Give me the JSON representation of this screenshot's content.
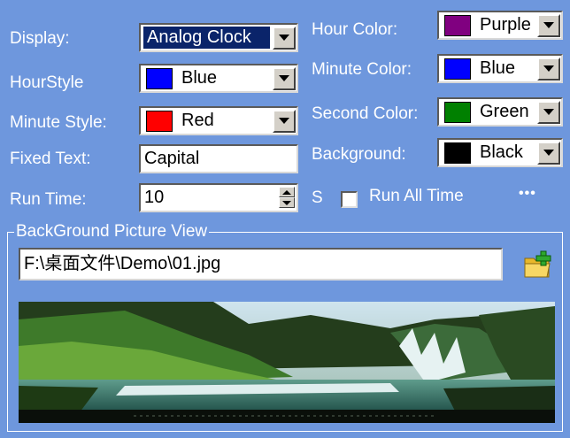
{
  "labels": {
    "display": "Display:",
    "hour_style": "HourStyle",
    "minute_style": "Minute Style:",
    "fixed_text": "Fixed Text:",
    "run_time": "Run Time:",
    "hour_color": "Hour Color:",
    "minute_color": "Minute Color:",
    "second_color": "Second Color:",
    "background": "Background:",
    "seconds_unit": "S",
    "run_all_time": "Run All Time",
    "more": "•••"
  },
  "fields": {
    "display": "Analog Clock",
    "hour_style": "Blue",
    "minute_style": "Red",
    "fixed_text": "Capital",
    "run_time": "10",
    "hour_color": "Purple",
    "minute_color": "Blue",
    "second_color": "Green",
    "background": "Black",
    "run_all_time_checked": false
  },
  "swatch_colors": {
    "hour_style": "#0000ff",
    "minute_style": "#ff0000",
    "hour_color": "#800080",
    "minute_color": "#0000ff",
    "second_color": "#008000",
    "background": "#000000"
  },
  "picture_group": {
    "title": "BackGround Picture View",
    "path": "F:\\桌面文件\\Demo\\01.jpg",
    "open_icon": "folder-add-icon"
  },
  "colors": {
    "panel_bg": "#6e97dd",
    "selection": "#0a246a"
  }
}
